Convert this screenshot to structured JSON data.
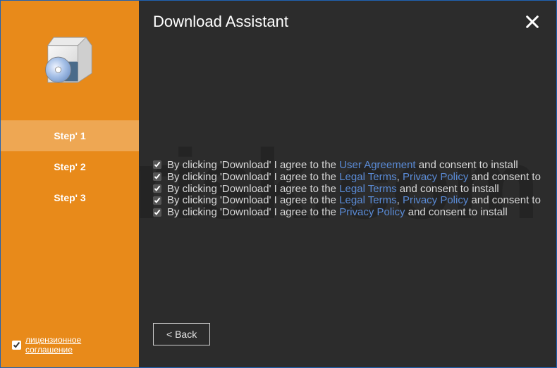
{
  "watermark": "pcrisk.com",
  "header": {
    "title": "Download Assistant"
  },
  "sidebar": {
    "steps": [
      {
        "label": "Step' 1",
        "active": true
      },
      {
        "label": "Step' 2",
        "active": false
      },
      {
        "label": "Step' 3",
        "active": false
      }
    ],
    "license": {
      "label": "лицензионное соглашение",
      "checked": true
    }
  },
  "consent": {
    "prefix": "By clicking 'Download' I agree to the ",
    "suffix_install": " and consent to install",
    "suffix_consent_to": " and consent to",
    "items": [
      {
        "links": [
          "User Agreement"
        ],
        "suffix_key": "suffix_install"
      },
      {
        "links": [
          "Legal Terms",
          "Privacy Policy"
        ],
        "suffix_key": "suffix_consent_to"
      },
      {
        "links": [
          "Legal Terms"
        ],
        "suffix_key": "suffix_install"
      },
      {
        "links": [
          "Legal Terms",
          "Privacy Policy"
        ],
        "suffix_key": "suffix_consent_to"
      },
      {
        "links": [
          "Privacy Policy"
        ],
        "suffix_key": "suffix_install"
      }
    ]
  },
  "footer": {
    "back_label": "<  Back"
  },
  "icons": {
    "close": "close-icon",
    "box": "installer-box-icon"
  }
}
